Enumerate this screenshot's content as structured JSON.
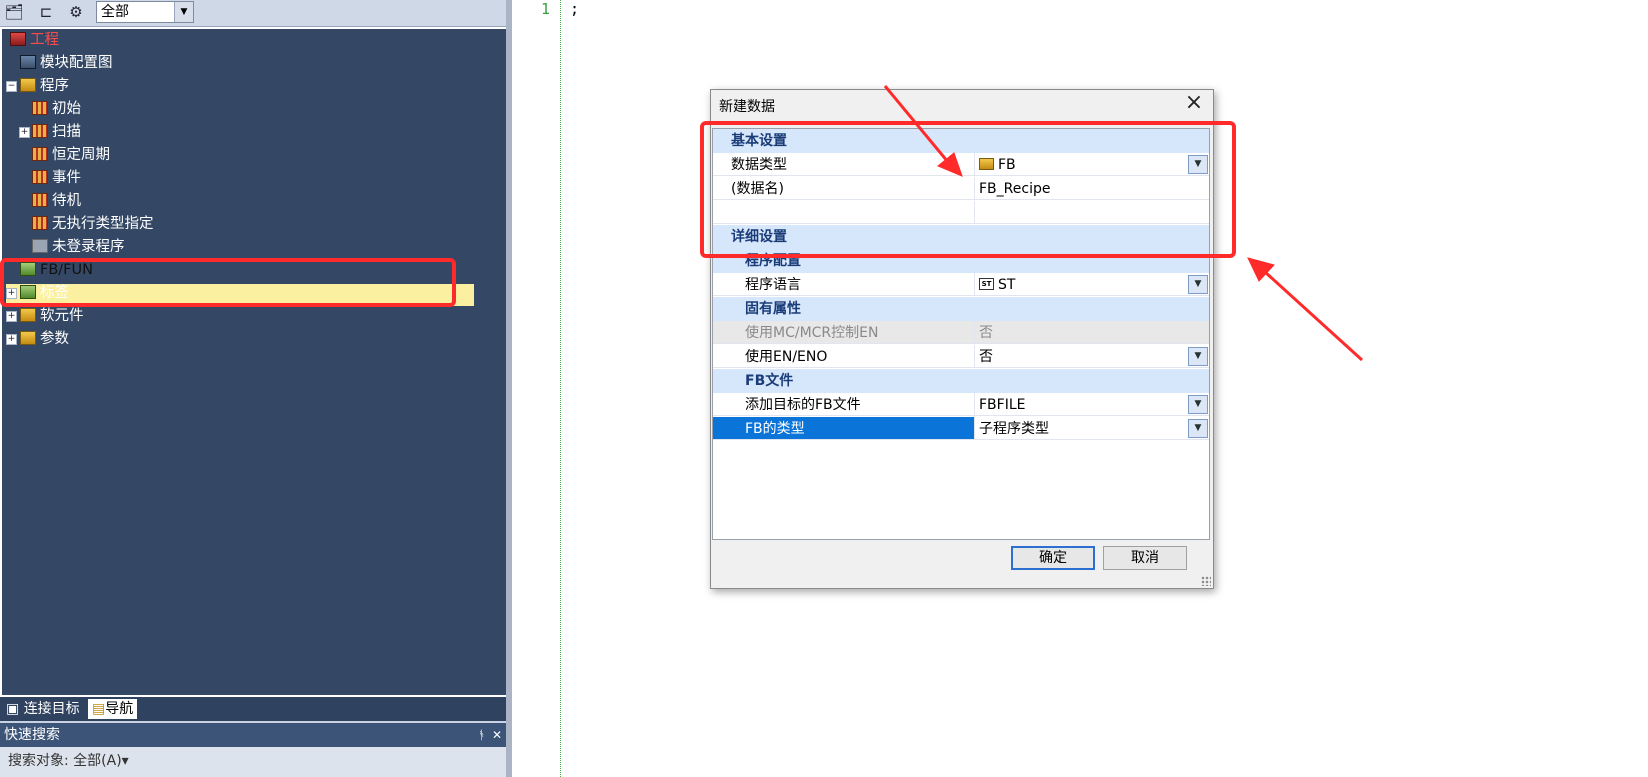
{
  "toolbar": {
    "scope_value": "全部"
  },
  "tree": {
    "project": "工程",
    "module_config": "模块配置图",
    "program": "程序",
    "initial": "初始",
    "scan": "扫描",
    "fixed_cycle": "恒定周期",
    "event": "事件",
    "standby": "待机",
    "no_exec_type": "无执行类型指定",
    "unregistered": "未登录程序",
    "fb_fun": "FB/FUN",
    "labels": "标签",
    "devices": "软元件",
    "parameters": "参数"
  },
  "bottom_tabs": {
    "connection": "连接目标",
    "navigation": "导航"
  },
  "quick_search": {
    "title": "快速搜索",
    "target": "搜索对象: 全部(A)"
  },
  "editor": {
    "line_number": "1",
    "code": ";"
  },
  "dialog": {
    "title": "新建数据",
    "basic_settings": "基本设置",
    "data_type_label": "数据类型",
    "data_type_value": "FB",
    "data_name_label": "(数据名)",
    "data_name_value": "FB_Recipe",
    "detail_settings": "详细设置",
    "program_config": "程序配置",
    "program_language_label": "程序语言",
    "program_language_value": "ST",
    "inherent_props": "固有属性",
    "use_mc_mcr_label": "使用MC/MCR控制EN",
    "use_mc_mcr_value": "否",
    "use_en_eno_label": "使用EN/ENO",
    "use_en_eno_value": "否",
    "fb_file": "FB文件",
    "add_target_fb_file_label": "添加目标的FB文件",
    "add_target_fb_file_value": "FBFILE",
    "fb_type_label": "FB的类型",
    "fb_type_value": "子程序类型",
    "ok": "确定",
    "cancel": "取消"
  },
  "colors": {
    "tree_bg": "#344865",
    "highlight_row": "#fbf0a0",
    "category_bg": "#d6e6fb",
    "selection": "#0a74d8",
    "annotation_red": "#ff2a2a"
  }
}
